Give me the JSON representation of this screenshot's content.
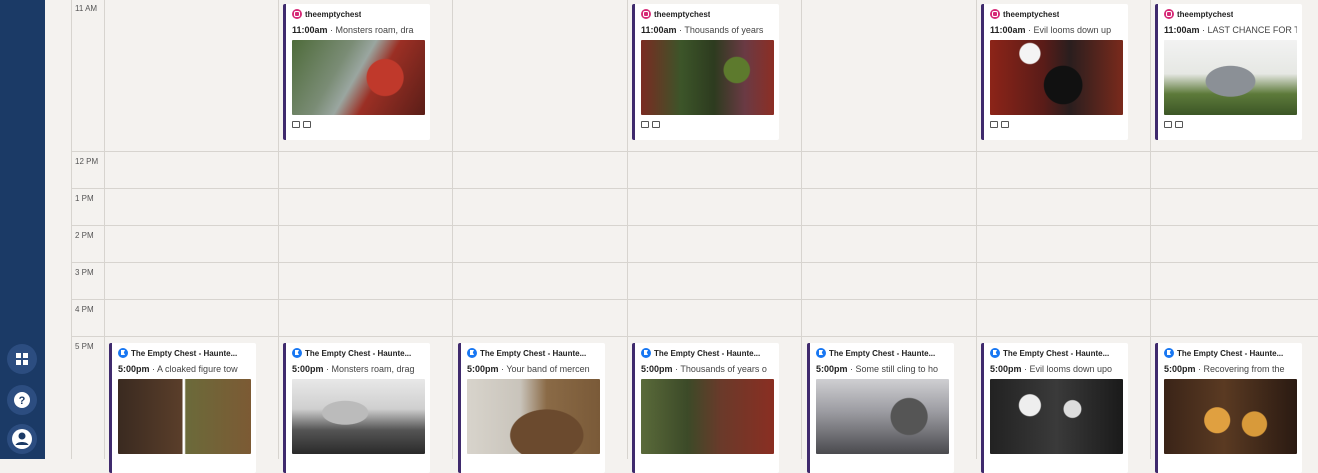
{
  "sidebar": {
    "top_icon": "menu-dots-icon",
    "buttons": [
      {
        "name": "grid-icon"
      },
      {
        "name": "help-icon"
      },
      {
        "name": "avatar"
      }
    ]
  },
  "time_labels": [
    "11 AM",
    "12 PM",
    "1 PM",
    "2 PM",
    "3 PM",
    "4 PM",
    "5 PM"
  ],
  "top_posts": [
    {
      "account": "theemptychest",
      "time": "11:00am",
      "sep": " · ",
      "caption": "Monsters roam, dra",
      "network": "instagram"
    },
    {
      "account": "theemptychest",
      "time": "11:00am",
      "sep": " · ",
      "caption": "Thousands of years",
      "network": "instagram"
    },
    {
      "account": "theemptychest",
      "time": "11:00am",
      "sep": " · ",
      "caption": "Evil looms down up",
      "network": "instagram"
    },
    {
      "account": "theemptychest",
      "time": "11:00am",
      "sep": " · ",
      "caption": "LAST CHANCE FOR T",
      "network": "instagram"
    }
  ],
  "bottom_posts": [
    {
      "account": "The Empty Chest - Haunte...",
      "time": "5:00pm",
      "sep": " · ",
      "caption": "A cloaked figure tow",
      "network": "facebook"
    },
    {
      "account": "The Empty Chest - Haunte...",
      "time": "5:00pm",
      "sep": " · ",
      "caption": "Monsters roam, drag",
      "network": "facebook"
    },
    {
      "account": "The Empty Chest - Haunte...",
      "time": "5:00pm",
      "sep": " · ",
      "caption": "Your band of mercen",
      "network": "facebook"
    },
    {
      "account": "The Empty Chest - Haunte...",
      "time": "5:00pm",
      "sep": " · ",
      "caption": "Thousands of years o",
      "network": "facebook"
    },
    {
      "account": "The Empty Chest - Haunte...",
      "time": "5:00pm",
      "sep": " · ",
      "caption": "Some still cling to ho",
      "network": "facebook"
    },
    {
      "account": "The Empty Chest - Haunte...",
      "time": "5:00pm",
      "sep": " · ",
      "caption": "Evil looms down upo",
      "network": "facebook"
    },
    {
      "account": "The Empty Chest - Haunte...",
      "time": "5:00pm",
      "sep": " · ",
      "caption": "Recovering from the",
      "network": "facebook"
    }
  ],
  "colors": {
    "sidebar": "#1b3a66",
    "card_accent": "#3f2a6d",
    "instagram": "#d62976",
    "facebook": "#1877f2",
    "background": "#f4f2ef"
  }
}
